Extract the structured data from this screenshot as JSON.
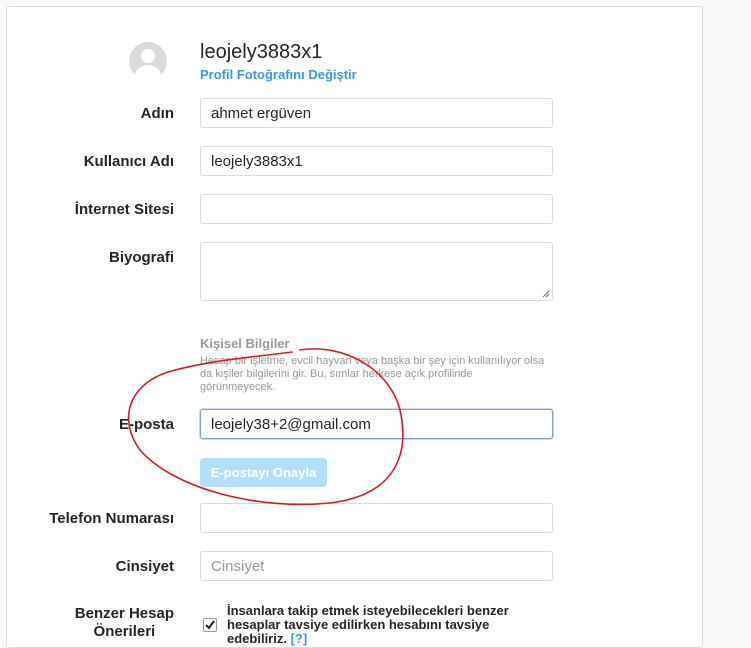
{
  "profile": {
    "username": "leojely3883x1",
    "change_photo_label": "Profil Fotoğrafını Değiştir"
  },
  "fields": {
    "name": {
      "label": "Adın",
      "value": "ahmet ergüven"
    },
    "username": {
      "label": "Kullanıcı Adı",
      "value": "leojely3883x1"
    },
    "website": {
      "label": "İnternet Sitesi",
      "value": ""
    },
    "bio": {
      "label": "Biyografi",
      "value": ""
    },
    "email": {
      "label": "E-posta",
      "value": "leojely38+2@gmail.com"
    },
    "phone": {
      "label": "Telefon Numarası",
      "value": ""
    },
    "gender": {
      "label": "Cinsiyet",
      "placeholder": "Cinsiyet"
    }
  },
  "personal_info": {
    "title": "Kişisel Bilgiler",
    "description": "Hesap bir işletme, evcil hayvan veya başka bir şey için kullanılıyor olsa da kişiler bilgilerini gir. Bu, sımlar herkese açık profilinde görünmeyecek."
  },
  "confirm_email_label": "E-postayı Onayla",
  "similar_accounts": {
    "label_line1": "Benzer Hesap",
    "label_line2": "Önerileri",
    "checked": true,
    "text": "İnsanlara takip etmek isteyebilecekleri benzer hesaplar tavsiye edilirken hesabını",
    "text_tail": "tavsiye edebiliriz.",
    "help_link": "[?]"
  },
  "colors": {
    "link": "#3897f0",
    "button_disabled": "#b2dffc",
    "annotation": "#e0191e"
  }
}
